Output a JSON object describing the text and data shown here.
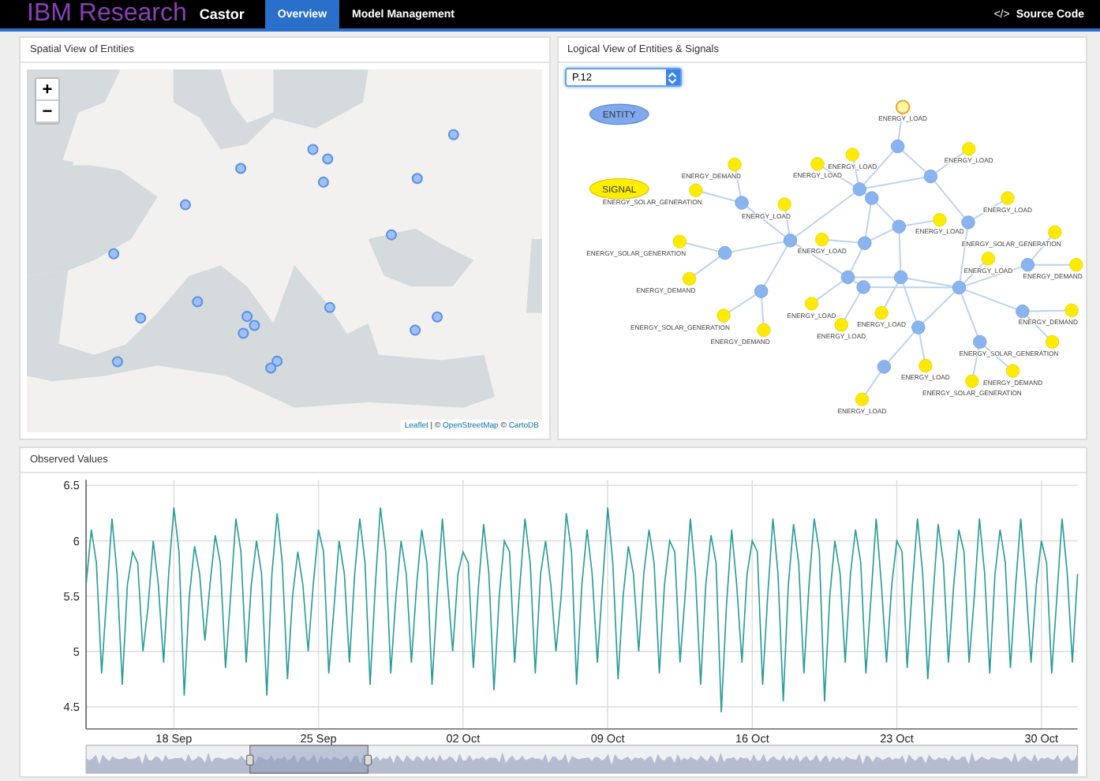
{
  "navbar": {
    "brand": "IBM Research",
    "app_name": "Castor",
    "tabs": [
      {
        "label": "Overview",
        "selected": true
      },
      {
        "label": "Model Management",
        "selected": false
      }
    ],
    "source_icon": "</>",
    "source_link": "Source Code"
  },
  "spatial_panel": {
    "title": "Spatial View of Entities",
    "zoom_in": "+",
    "zoom_out": "−",
    "attribution": {
      "links": [
        "Leaflet",
        "OpenStreetMap",
        "CartoDB"
      ],
      "separators": [
        "| ©",
        "©"
      ]
    }
  },
  "logical_panel": {
    "title": "Logical View of Entities & Signals",
    "selector": {
      "value": "P.12"
    },
    "legend": [
      {
        "label": "ENTITY",
        "kind": "entity"
      },
      {
        "label": "SIGNAL",
        "kind": "signal"
      }
    ],
    "signals": [
      {
        "label": "ENERGY_LOAD",
        "selected": true
      },
      {
        "label": "ENERGY_LOAD",
        "selected": false
      },
      {
        "label": "ENERGY_LOAD",
        "selected": false
      },
      {
        "label": "ENERGY_DEMAND",
        "selected": false
      },
      {
        "label": "ENERGY_LOAD",
        "selected": false
      },
      {
        "label": "ENERGY_SOLAR_GENERATION",
        "selected": false
      },
      {
        "label": "ENERGY_LOAD",
        "selected": false
      },
      {
        "label": "ENERGY_LOAD",
        "selected": false
      },
      {
        "label": "ENERGY_LOAD",
        "selected": false
      },
      {
        "label": "ENERGY_SOLAR_GENERATION",
        "selected": false
      },
      {
        "label": "ENERGY_LOAD",
        "selected": false
      },
      {
        "label": "ENERGY_SOLAR_GENERATION",
        "selected": false
      },
      {
        "label": "ENERGY_LOAD",
        "selected": false
      },
      {
        "label": "ENERGY_DEMAND",
        "selected": false
      },
      {
        "label": "ENERGY_DEMAND",
        "selected": false
      },
      {
        "label": "ENERGY_LOAD",
        "selected": false
      },
      {
        "label": "ENERGY_LOAD",
        "selected": false
      },
      {
        "label": "ENERGY_DEMAND",
        "selected": false
      },
      {
        "label": "ENERGY_SOLAR_GENERATION",
        "selected": false
      },
      {
        "label": "ENERGY_LOAD",
        "selected": false
      },
      {
        "label": "ENERGY_DEMAND",
        "selected": false
      },
      {
        "label": "ENERGY_SOLAR_GENERATION",
        "selected": false
      },
      {
        "label": "ENERGY_LOAD",
        "selected": false
      },
      {
        "label": "ENERGY_DEMAND",
        "selected": false
      },
      {
        "label": "ENERGY_SOLAR_GENERATION",
        "selected": false
      },
      {
        "label": "ENERGY_LOAD",
        "selected": false
      }
    ]
  },
  "observed_panel": {
    "title": "Observed Values",
    "x_labels": [
      "18 Sep",
      "25 Sep",
      "02 Oct",
      "09 Oct",
      "16 Oct",
      "23 Oct",
      "30 Oct"
    ],
    "chart_data": {
      "type": "line",
      "grid": true,
      "ylim": [
        4.3,
        6.55
      ],
      "yticks": [
        6.5,
        6,
        5.5,
        5,
        4.5
      ],
      "series": [
        {
          "color": "#2a9d98",
          "values": [
            5.6,
            6.1,
            5.8,
            4.8,
            5.5,
            6.2,
            5.7,
            4.7,
            5.6,
            5.9,
            5.8,
            5.0,
            5.4,
            6.0,
            5.6,
            4.9,
            5.7,
            6.3,
            5.9,
            4.6,
            5.5,
            5.95,
            5.7,
            5.1,
            5.6,
            6.05,
            5.8,
            4.85,
            5.5,
            6.2,
            5.9,
            4.9,
            5.6,
            6.0,
            5.7,
            4.6,
            5.7,
            6.25,
            5.8,
            4.75,
            5.5,
            5.9,
            5.6,
            5.0,
            5.6,
            6.1,
            5.9,
            4.8,
            5.4,
            6.0,
            5.7,
            4.9,
            5.7,
            6.2,
            5.8,
            4.7,
            5.6,
            6.3,
            5.9,
            4.8,
            5.5,
            6.0,
            5.7,
            4.9,
            5.6,
            6.1,
            5.8,
            4.7,
            5.5,
            6.2,
            5.6,
            5.0,
            5.7,
            5.9,
            5.8,
            4.85,
            5.6,
            6.15,
            5.7,
            4.65,
            5.5,
            6.0,
            5.9,
            4.9,
            5.6,
            6.2,
            5.8,
            4.8,
            5.7,
            6.0,
            5.6,
            5.0,
            5.5,
            6.25,
            5.9,
            4.7,
            5.6,
            6.1,
            5.7,
            4.9,
            5.6,
            6.3,
            5.8,
            4.75,
            5.5,
            5.95,
            5.7,
            5.0,
            5.7,
            6.1,
            5.8,
            4.8,
            5.6,
            6.0,
            5.9,
            4.9,
            5.5,
            6.2,
            5.7,
            4.7,
            5.6,
            6.05,
            5.8,
            4.45,
            5.4,
            6.1,
            5.6,
            4.9,
            5.7,
            6.0,
            5.9,
            4.7,
            5.5,
            6.2,
            5.7,
            4.55,
            5.6,
            6.15,
            5.8,
            4.8,
            5.6,
            6.2,
            5.9,
            4.55,
            5.5,
            6.0,
            5.7,
            4.9,
            5.7,
            6.1,
            5.8,
            4.8,
            5.5,
            6.2,
            5.6,
            4.9,
            5.6,
            6.0,
            5.9,
            4.85,
            5.6,
            6.2,
            5.7,
            4.75,
            5.5,
            6.15,
            5.8,
            4.9,
            5.6,
            6.1,
            5.9,
            4.9,
            5.5,
            6.2,
            5.7,
            4.8,
            5.7,
            6.1,
            5.8,
            4.85,
            5.6,
            6.2,
            5.6,
            4.9,
            5.6,
            6.0,
            5.8,
            4.8,
            5.5,
            6.2,
            5.7,
            4.9,
            5.7
          ]
        }
      ]
    }
  }
}
